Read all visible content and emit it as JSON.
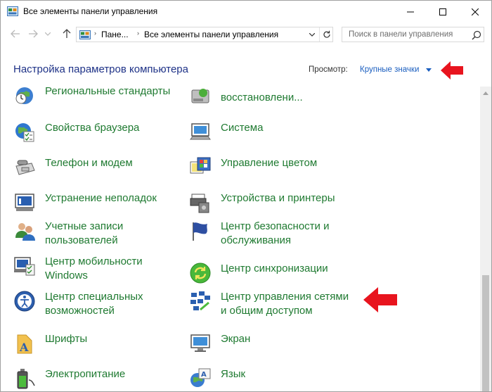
{
  "window": {
    "title": "Все элементы панели управления",
    "minimize_icon": "minimize-icon",
    "maximize_icon": "maximize-icon",
    "close_icon": "close-icon"
  },
  "address_bar": {
    "crumbs": [
      "Пане...",
      "Все элементы панели управления"
    ],
    "search_placeholder": "Поиск в панели управления"
  },
  "header": {
    "title": "Настройка параметров компьютера",
    "view_label": "Просмотр:",
    "view_value": "Крупные значки"
  },
  "items_left": [
    {
      "label": "Региональные стандарты",
      "icon": "regional-settings-icon"
    },
    {
      "label": "Свойства браузера",
      "icon": "internet-options-icon"
    },
    {
      "label": "Телефон и модем",
      "icon": "phone-modem-icon"
    },
    {
      "label": "Устранение неполадок",
      "icon": "troubleshooting-icon"
    },
    {
      "label": "Учетные записи\nпользователей",
      "icon": "user-accounts-icon"
    },
    {
      "label": "Центр мобильности\nWindows",
      "icon": "mobility-center-icon"
    },
    {
      "label": "Центр специальных\nвозможностей",
      "icon": "ease-of-access-icon"
    },
    {
      "label": "Шрифты",
      "icon": "fonts-icon"
    },
    {
      "label": "Электропитание",
      "icon": "power-options-icon"
    }
  ],
  "items_right": [
    {
      "label": "восстановлени...",
      "icon": "backup-restore-icon"
    },
    {
      "label": "Система",
      "icon": "system-icon"
    },
    {
      "label": "Управление цветом",
      "icon": "color-management-icon"
    },
    {
      "label": "Устройства и принтеры",
      "icon": "devices-printers-icon"
    },
    {
      "label": "Центр безопасности и\nобслуживания",
      "icon": "security-maintenance-icon"
    },
    {
      "label": "Центр синхронизации",
      "icon": "sync-center-icon"
    },
    {
      "label": "Центр управления сетями\nи общим доступом",
      "icon": "network-sharing-icon"
    },
    {
      "label": "Экран",
      "icon": "display-icon"
    },
    {
      "label": "Язык",
      "icon": "language-icon"
    }
  ],
  "colors": {
    "link_green": "#1f7a31",
    "title_blue": "#1e3287",
    "accent_blue": "#1a5ebf",
    "annotation_red": "#e8141e"
  }
}
